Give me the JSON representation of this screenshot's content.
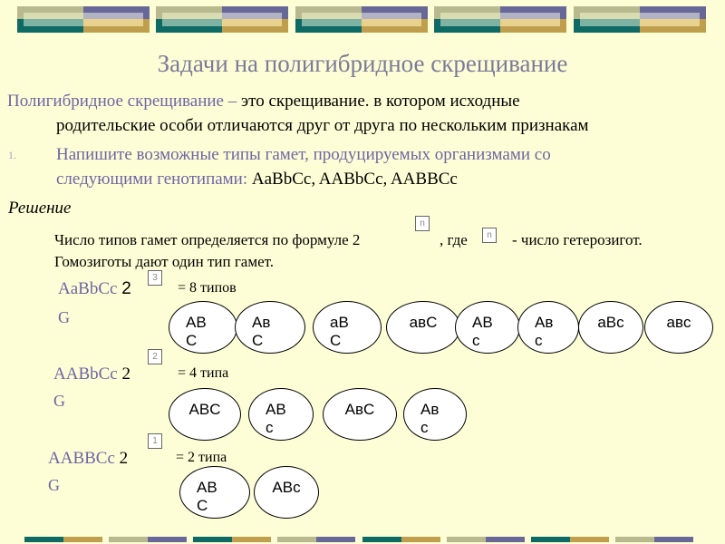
{
  "title": "Задачи на полигибридное скрещивание",
  "definition": {
    "term": "Полигибридное скрещивание –",
    "text_line1": " это скрещивание. в котором исходные",
    "text_line2": "родительские особи отличаются друг от друга по нескольким признакам"
  },
  "task": {
    "number": "1.",
    "line1": "Напишите возможные типы гамет, продуцируемых организмами со",
    "line2_prefix": "следующими генотипами: ",
    "line2_genotypes": "AaBbCc, AABbCc, AABBCc"
  },
  "solution": {
    "heading": "Решение",
    "formula_text": "Число типов гамет определяется по формуле 2",
    "formula_exponent": "n",
    "formula_where": ", где",
    "formula_var": "n",
    "formula_rest": "- число гетерозигот.",
    "homozygote_note": "Гомозиготы дают один тип гамет."
  },
  "examples": [
    {
      "genotype": "AaBbCc",
      "base": "2",
      "exponent": "3",
      "result": "= 8 типов",
      "gamete_label": "G",
      "gametes": [
        "AB\nC",
        "Aв\nC",
        "aB\nC",
        "aвC",
        "AB\nc",
        "Aв\nc",
        "aBc",
        "aвc"
      ]
    },
    {
      "genotype": "AABbCc",
      "base": "2",
      "exponent": "2",
      "result": "= 4 типа",
      "gamete_label": "G",
      "gametes": [
        "ABC",
        "AB\nc",
        "AвC",
        "Aв\nc"
      ]
    },
    {
      "genotype": "AABBCc",
      "base": "2",
      "exponent": "1",
      "result": "= 2 типа",
      "gamete_label": "G",
      "gametes": [
        "AB\nC",
        "ABc"
      ]
    }
  ],
  "colors": {
    "background": "#fefed6",
    "accent_purple": "#6d65a5",
    "title_gray": "#7a7a9a",
    "teal": "#0e6a64",
    "gold": "#bf9f4e",
    "tan": "#b9b98f",
    "slate_purple": "#686898"
  }
}
